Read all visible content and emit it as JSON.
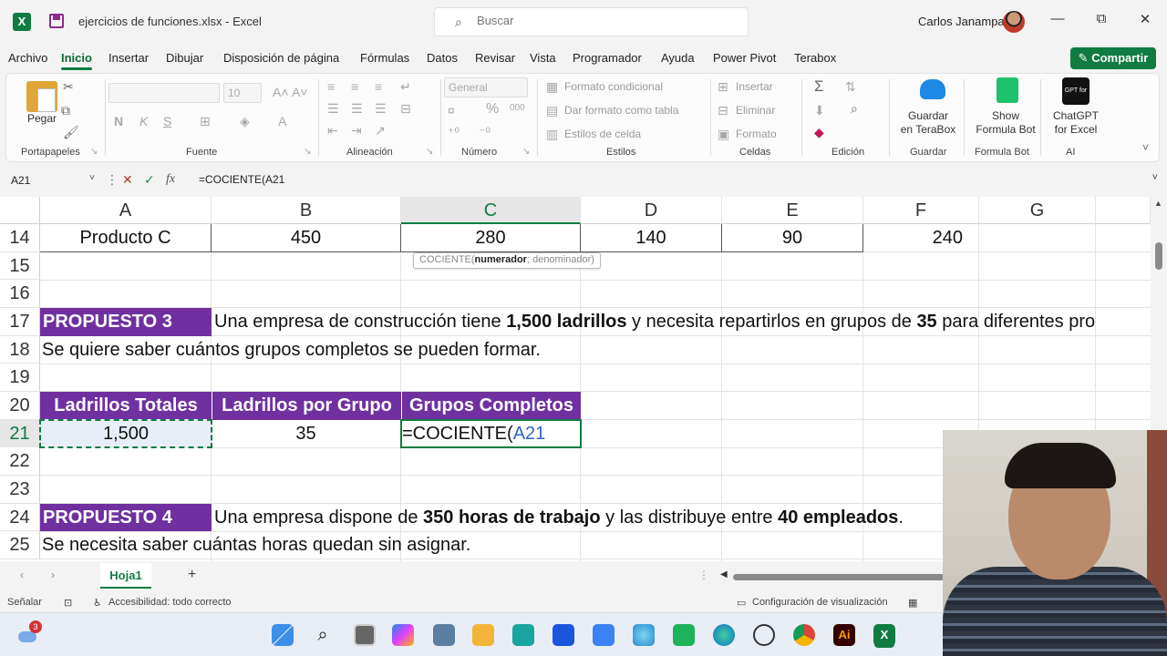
{
  "titlebar": {
    "app_icon": "X",
    "doc_name": "ejercicios de funciones.xlsx",
    "separator": " - ",
    "app_name": "Excel",
    "search_placeholder": "Buscar",
    "user_name": "Carlos Janampa",
    "minimize": "—",
    "restore": "⧉",
    "close": "✕"
  },
  "menu": {
    "tabs": [
      "Archivo",
      "Inicio",
      "Insertar",
      "Dibujar",
      "Disposición de página",
      "Fórmulas",
      "Datos",
      "Revisar",
      "Vista",
      "Programador",
      "Ayuda",
      "Power Pivot",
      "Terabox"
    ],
    "active": "Inicio",
    "share_label": "Compartir"
  },
  "ribbon": {
    "portapapeles": {
      "label": "Portapapeles",
      "paste": "Pegar"
    },
    "fuente": {
      "label": "Fuente",
      "size": "10",
      "bold": "N",
      "italic": "K",
      "underline": "S"
    },
    "alineacion": {
      "label": "Alineación"
    },
    "numero": {
      "label": "Número",
      "format": "General",
      "percent": "%",
      "thousands": "000"
    },
    "estilos": {
      "label": "Estilos",
      "cond_format": "Formato condicional",
      "table_format": "Dar formato como tabla",
      "cell_styles": "Estilos de celda"
    },
    "celdas": {
      "label": "Celdas",
      "insert": "Insertar",
      "delete": "Eliminar",
      "format": "Formato"
    },
    "edicion": {
      "label": "Edición"
    },
    "guardar": {
      "label": "Guardar",
      "btn_line1": "Guardar",
      "btn_line2": "en TeraBox"
    },
    "formula_bot": {
      "label": "Formula Bot",
      "btn_line1": "Show",
      "btn_line2": "Formula Bot"
    },
    "ai": {
      "label": "AI",
      "btn_line1": "ChatGPT",
      "btn_line2": "for Excel",
      "icon_text": "GPT for"
    }
  },
  "formula_bar": {
    "name_box": "A21",
    "formula": "=COCIENTE(A21",
    "cancel": "✕",
    "enter": "✓",
    "fx": "fx"
  },
  "columns": [
    "A",
    "B",
    "C",
    "D",
    "E",
    "F",
    "G"
  ],
  "rows": [
    "14",
    "15",
    "16",
    "17",
    "18",
    "19",
    "20",
    "21",
    "22",
    "23",
    "24",
    "25"
  ],
  "cells": {
    "r14": {
      "A": "Producto C",
      "B": "450",
      "C": "280",
      "D": "140",
      "E": "90",
      "F": "240"
    },
    "r17": {
      "A": "PROPUESTO 3",
      "B_parts": [
        "Una empresa de construcción tiene ",
        "1,500 ladrillos",
        " y necesita repartirlos en grupos de ",
        "35",
        " para diferentes pro"
      ]
    },
    "r18": {
      "A": "Se quiere saber cuántos grupos completos se pueden formar."
    },
    "r20": {
      "A": "Ladrillos Totales",
      "B": "Ladrillos por Grupo",
      "C": "Grupos Completos"
    },
    "r21": {
      "A": "1,500",
      "B": "35",
      "C_prefix": "=COCIENTE(",
      "C_ref": "A21"
    },
    "r24": {
      "A": "PROPUESTO 4",
      "B_parts": [
        "Una empresa dispone de ",
        "350 horas de trabajo",
        " y las distribuye entre ",
        "40 empleados",
        "."
      ]
    },
    "r25": {
      "A": "Se necesita saber cuántas horas quedan sin asignar."
    }
  },
  "tooltip": {
    "fn": "COCIENTE(",
    "arg1": "numerador",
    "rest": "; denominador)"
  },
  "sheets": {
    "active": "Hoja1",
    "add": "+"
  },
  "status": {
    "mode": "Señalar",
    "accessibility": "Accesibilidad: todo correcto",
    "view_settings": "Configuración de visualización"
  },
  "taskbar": {
    "weather_badge": "3"
  },
  "colors": {
    "excel_green": "#107c41",
    "purple_header": "#7030a0",
    "ref_blue": "#2f66c7"
  }
}
